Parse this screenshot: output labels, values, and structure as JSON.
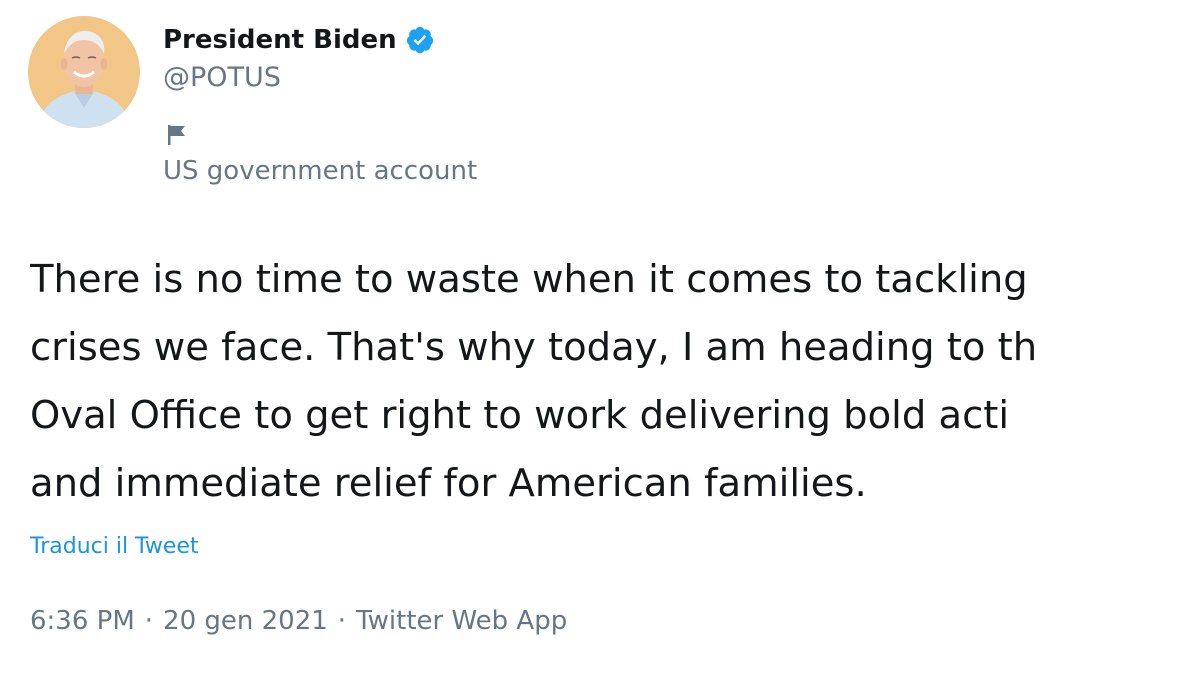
{
  "author": {
    "display_name": "President Biden",
    "handle": "@POTUS",
    "verified": true,
    "verified_icon": "verified-badge-icon",
    "label_icon": "flag-icon",
    "account_label": "US government account",
    "avatar": "profile-photo"
  },
  "tweet": {
    "lines": [
      "There is no time to waste when it comes to tackling",
      "crises we face. That's why today, I am heading to th",
      "Oval Office to get right to work delivering bold acti",
      "and immediate relief for American families."
    ],
    "translate_label": "Traduci il Tweet"
  },
  "meta": {
    "time": "6:36 PM",
    "separator": "·",
    "date": "20 gen 2021",
    "source": "Twitter Web App"
  },
  "colors": {
    "text": "#14171a",
    "secondary": "#657786",
    "link": "#1b95e0",
    "verified": "#1da1f2"
  }
}
